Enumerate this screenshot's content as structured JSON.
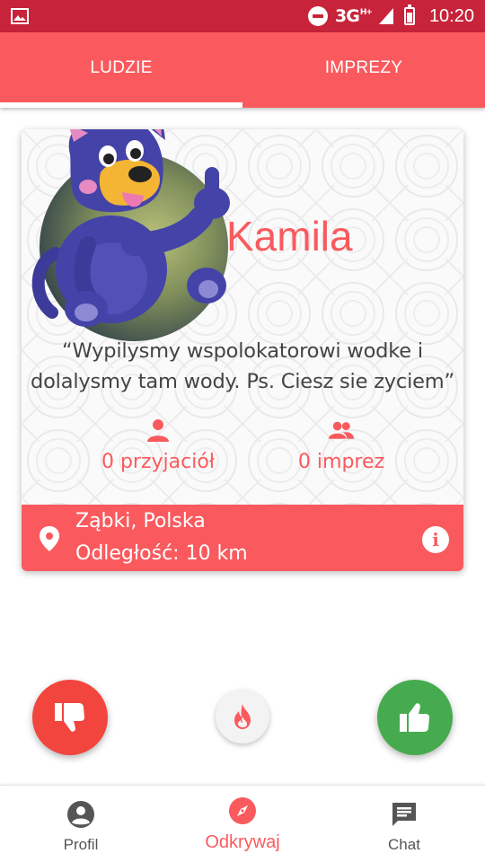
{
  "status_bar": {
    "network": "3G",
    "network_sup": "H+",
    "time": "10:20"
  },
  "tabs": [
    {
      "label": "LUDZIE",
      "active": true
    },
    {
      "label": "IMPREZY",
      "active": false
    }
  ],
  "profile": {
    "name": "Kamila",
    "quote_line1": "“Wypilysmy wspolokatorowi wodke i",
    "quote_line2": "dolalysmy tam wody. Ps. Ciesz sie zyciem”",
    "friends_label": "0 przyjaciół",
    "parties_label": "0 imprez",
    "location": "Ząbki, Polska",
    "distance": "Odległość: 10 km",
    "info_symbol": "i"
  },
  "actions": {
    "dislike_icon": "thumbs-down-icon",
    "superlike_icon": "fire-icon",
    "like_icon": "thumbs-up-icon"
  },
  "bottom_nav": [
    {
      "label": "Profil",
      "icon": "account-circle-icon",
      "active": false
    },
    {
      "label": "Odkrywaj",
      "icon": "compass-icon",
      "active": true
    },
    {
      "label": "Chat",
      "icon": "chat-bubble-icon",
      "active": false
    }
  ],
  "colors": {
    "status_bar": "#c7233a",
    "accent": "#fa5a5e",
    "dislike": "#f2453d",
    "like": "#46ab4e"
  }
}
